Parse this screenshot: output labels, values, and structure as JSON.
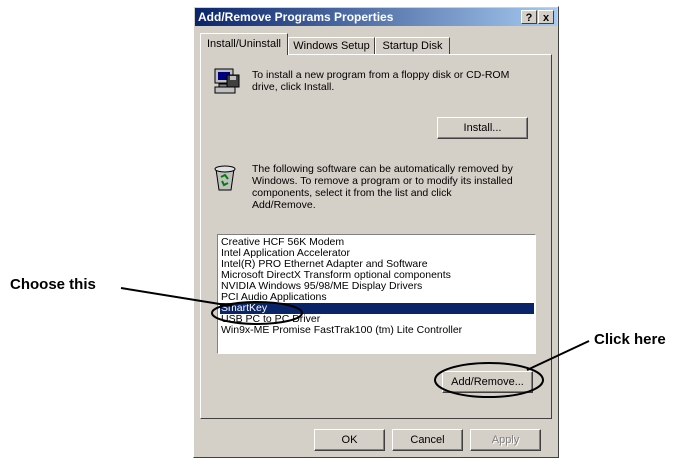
{
  "dialog": {
    "title": "Add/Remove Programs Properties",
    "help_btn": "?",
    "close_btn": "x"
  },
  "tabs": [
    "Install/Uninstall",
    "Windows Setup",
    "Startup Disk"
  ],
  "install_section": {
    "description_line1": "To install a new program from a floppy disk or CD-ROM",
    "description_line2": "drive, click Install.",
    "install_button": "Install..."
  },
  "uninstall_section": {
    "description_lines": [
      "The following software can be automatically removed by",
      "Windows. To remove a program or to modify its installed",
      "components, select it from the list and click",
      "Add/Remove."
    ]
  },
  "programs": [
    "Creative HCF 56K Modem",
    "Intel Application Accelerator",
    "Intel(R) PRO Ethernet Adapter and Software",
    "Microsoft DirectX Transform optional components",
    "NVIDIA Windows 95/98/ME Display Drivers",
    "PCI Audio Applications",
    "SmartKey",
    "USB PC to PC Driver",
    "Win9x-ME Promise FastTrak100 (tm) Lite Controller"
  ],
  "selected_program": "SmartKey",
  "add_remove_button": "Add/Remove...",
  "footer_buttons": {
    "ok": "OK",
    "cancel": "Cancel",
    "apply": "Apply"
  },
  "annotations": {
    "left": "Choose this",
    "right": "Click here"
  },
  "icons": {
    "install": "computer-floppy-icon",
    "uninstall": "recycle-bin-icon"
  }
}
